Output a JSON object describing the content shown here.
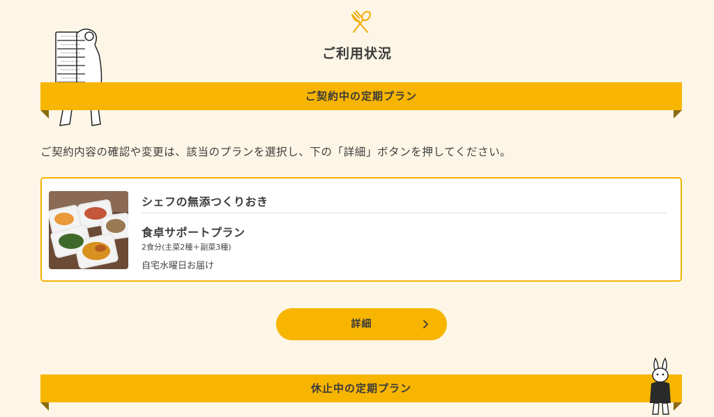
{
  "page": {
    "title": "ご利用状況",
    "instruction": "ご契約内容の確認や変更は、該当のプランを選択し、下の「詳細」ボタンを押してください。"
  },
  "sections": {
    "active_plans_heading": "ご契約中の定期プラン",
    "paused_plans_heading": "休止中の定期プラン"
  },
  "plan": {
    "service_name": "シェフの無添つくりおき",
    "plan_name": "食卓サポートプラン",
    "portion": "2食分(主菜2種＋副菜3種)",
    "delivery": "自宅水曜日お届け"
  },
  "actions": {
    "details_label": "詳細"
  },
  "icons": [
    "fork-spoon-icon",
    "chevron-right-icon",
    "bear-illustration",
    "rabbit-illustration"
  ],
  "colors": {
    "background": "#fdf6e6",
    "accent": "#f7b500",
    "card_border": "#f2b200"
  }
}
